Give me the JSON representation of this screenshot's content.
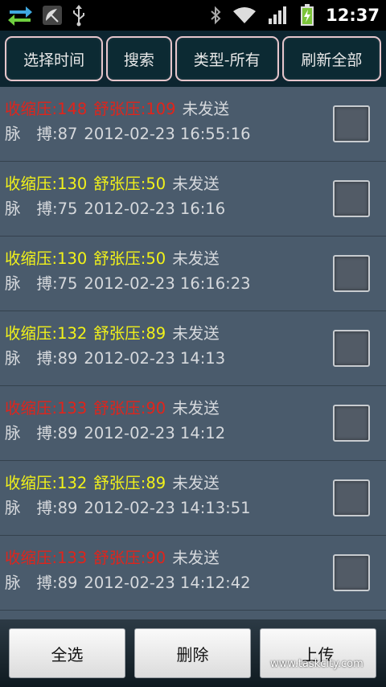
{
  "statusbar": {
    "time": "12:37",
    "icons": [
      "sync-arrows-icon",
      "satellite-dish-icon",
      "usb-icon",
      "bluetooth-icon",
      "wifi-icon",
      "signal-icon",
      "battery-charging-icon"
    ]
  },
  "toolbar": {
    "select_time": "选择时间",
    "search": "搜索",
    "type_all": "类型-所有",
    "refresh_all": "刷新全部"
  },
  "colors": {
    "red": "#e0241b",
    "yellow": "#f2f21a",
    "list_bg": "#4a5b6c",
    "toolbar_bg": "#0d2530"
  },
  "records": [
    {
      "systolic": "收缩压:148",
      "diastolic": "舒张压:109",
      "status": "未发送",
      "pulse_label": "脉",
      "pulse": "搏:87",
      "datetime": "2012-02-23 16:55:16",
      "color": "red"
    },
    {
      "systolic": "收缩压:130",
      "diastolic": "舒张压:50",
      "status": "未发送",
      "pulse_label": "脉",
      "pulse": "搏:75",
      "datetime": "2012-02-23 16:16",
      "color": "yellow"
    },
    {
      "systolic": "收缩压:130",
      "diastolic": "舒张压:50",
      "status": "未发送",
      "pulse_label": "脉",
      "pulse": "搏:75",
      "datetime": "2012-02-23 16:16:23",
      "color": "yellow"
    },
    {
      "systolic": "收缩压:132",
      "diastolic": "舒张压:89",
      "status": "未发送",
      "pulse_label": "脉",
      "pulse": "搏:89",
      "datetime": "2012-02-23 14:13",
      "color": "yellow"
    },
    {
      "systolic": "收缩压:133",
      "diastolic": "舒张压:90",
      "status": "未发送",
      "pulse_label": "脉",
      "pulse": "搏:89",
      "datetime": "2012-02-23 14:12",
      "color": "red"
    },
    {
      "systolic": "收缩压:132",
      "diastolic": "舒张压:89",
      "status": "未发送",
      "pulse_label": "脉",
      "pulse": "搏:89",
      "datetime": "2012-02-23 14:13:51",
      "color": "yellow"
    },
    {
      "systolic": "收缩压:133",
      "diastolic": "舒张压:90",
      "status": "未发送",
      "pulse_label": "脉",
      "pulse": "搏:89",
      "datetime": "2012-02-23 14:12:42",
      "color": "red"
    }
  ],
  "bottombar": {
    "select_all": "全选",
    "delete": "删除",
    "upload": "上传"
  },
  "watermark": "www.taskcity.com"
}
